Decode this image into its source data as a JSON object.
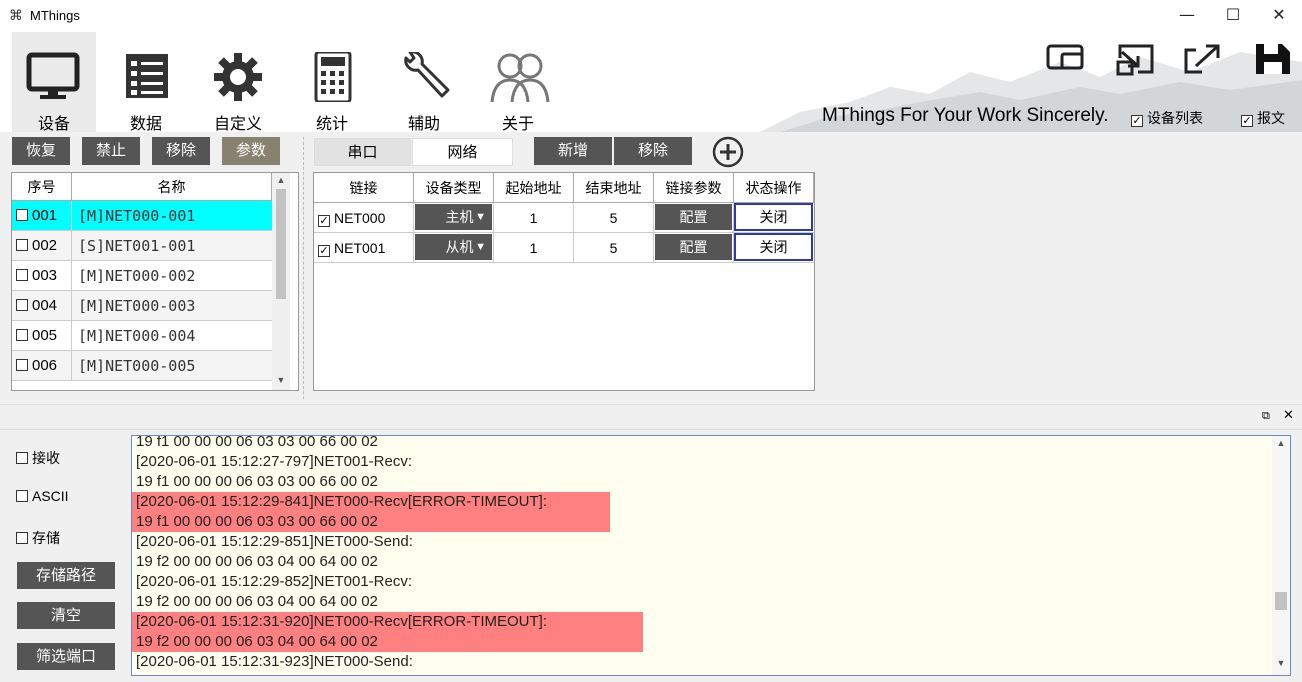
{
  "window": {
    "title": "MThings",
    "minimize": "—",
    "maximize": "☐",
    "close": "✕"
  },
  "ribbon": {
    "tabs": [
      {
        "label": "设备",
        "icon": "monitor-icon"
      },
      {
        "label": "数据",
        "icon": "list-icon"
      },
      {
        "label": "自定义",
        "icon": "gear-icon"
      },
      {
        "label": "统计",
        "icon": "calculator-icon"
      },
      {
        "label": "辅助",
        "icon": "wrench-icon"
      },
      {
        "label": "关于",
        "icon": "users-icon"
      }
    ],
    "slogan": "MThings For Your Work Sincerely.",
    "device_list_label": "设备列表",
    "message_label": "报文"
  },
  "left_toolbar": {
    "restore": "恢复",
    "disable": "禁止",
    "remove": "移除",
    "params": "参数"
  },
  "device_table": {
    "headers": [
      "序号",
      "名称"
    ],
    "rows": [
      {
        "num": "001",
        "name": "[M]NET000-001"
      },
      {
        "num": "002",
        "name": "[S]NET001-001"
      },
      {
        "num": "003",
        "name": "[M]NET000-002"
      },
      {
        "num": "004",
        "name": "[M]NET000-003"
      },
      {
        "num": "005",
        "name": "[M]NET000-004"
      },
      {
        "num": "006",
        "name": "[M]NET000-005"
      }
    ]
  },
  "link_tabs": {
    "serial": "串口",
    "network": "网络",
    "add": "新增",
    "remove": "移除"
  },
  "link_table": {
    "headers": [
      "链接",
      "设备类型",
      "起始地址",
      "结束地址",
      "链接参数",
      "状态操作"
    ],
    "rows": [
      {
        "link": "NET000",
        "type": "主机",
        "start": "1",
        "end": "5",
        "config": "配置",
        "action": "关闭"
      },
      {
        "link": "NET001",
        "type": "从机",
        "start": "1",
        "end": "5",
        "config": "配置",
        "action": "关闭"
      }
    ]
  },
  "bottom": {
    "receive": "接收",
    "ascii": "ASCII",
    "store": "存储",
    "store_path": "存储路径",
    "clear": "清空",
    "filter_port": "筛选端口"
  },
  "log": [
    {
      "text": "19 f1 00 00 00 06 03 03 00 66 00 02",
      "err": false
    },
    {
      "text": "[2020-06-01 15:12:27-797]NET001-Recv:",
      "err": false
    },
    {
      "text": "19 f1 00 00 00 06 03 03 00 66 00 02",
      "err": false
    },
    {
      "text": "[2020-06-01 15:12:29-841]NET000-Recv[ERROR-TIMEOUT]:",
      "err": true
    },
    {
      "text": "19 f1 00 00 00 06 03 03 00 66 00 02",
      "err": true
    },
    {
      "text": "[2020-06-01 15:12:29-851]NET000-Send:",
      "err": false
    },
    {
      "text": "19 f2 00 00 00 06 03 04 00 64 00 02",
      "err": false
    },
    {
      "text": "[2020-06-01 15:12:29-852]NET001-Recv:",
      "err": false
    },
    {
      "text": "19 f2 00 00 00 06 03 04 00 64 00 02",
      "err": false
    },
    {
      "text": "[2020-06-01 15:12:31-920]NET000-Recv[ERROR-TIMEOUT]:",
      "err": true
    },
    {
      "text": "19 f2 00 00 00 06 03 04 00 64 00 02",
      "err": true
    },
    {
      "text": "[2020-06-01 15:12:31-923]NET000-Send:",
      "err": false
    }
  ]
}
